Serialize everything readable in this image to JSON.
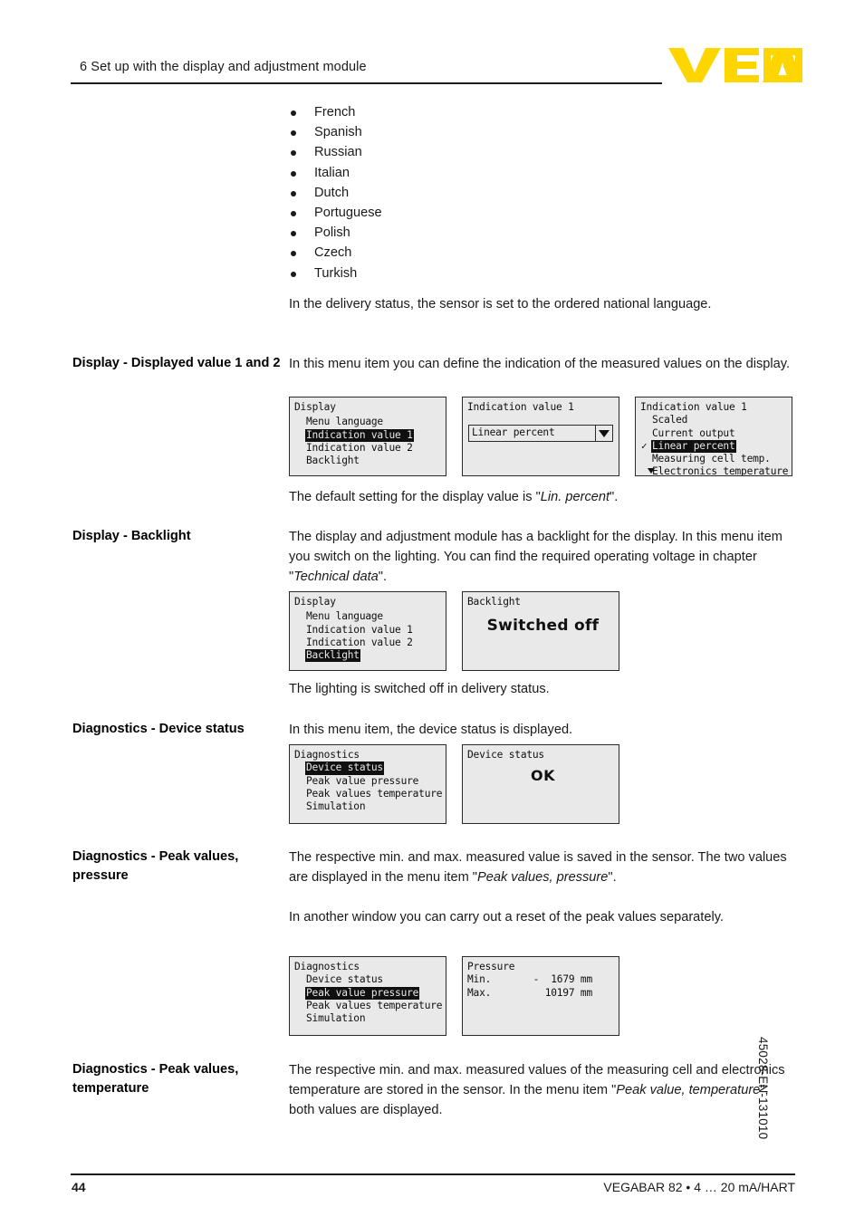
{
  "header": {
    "chapter_title": "6 Set up with the display and adjustment module",
    "logo_text": "VEGA",
    "logo_color": "#FFD500"
  },
  "language_list": [
    "French",
    "Spanish",
    "Russian",
    "Italian",
    "Dutch",
    "Portuguese",
    "Polish",
    "Czech",
    "Turkish"
  ],
  "intro_paragraph": "In the delivery status, the sensor is set to the ordered national language.",
  "sections": [
    {
      "heading": "Display - Displayed value 1 and 2",
      "body": "In this menu item you can define the indication of the measured values on the display.",
      "after_note_prefix": "The default setting for the display value is \"",
      "after_note_italic": "Lin. percent",
      "after_note_suffix": "\"."
    },
    {
      "heading": "Display - Backlight",
      "body_part1": "The display and adjustment module has a backlight for the display. In this menu item you switch on the lighting. You can find the required operating voltage in chapter  \"",
      "body_italic": "Technical data",
      "body_part2": "\".",
      "after_note": "The lighting is switched off in delivery status."
    },
    {
      "heading": "Diagnostics - Device status",
      "body": "In this menu item, the device status is displayed."
    },
    {
      "heading": "Diagnostics - Peak values, pressure",
      "body_part1": "The respective min. and max. measured value is saved in the sensor. The two values are displayed in the menu item \"",
      "body_italic": "Peak values, pressure",
      "body_part2": "\".",
      "body2": "In another window you can carry out a reset of the peak values separately."
    },
    {
      "heading": "Diagnostics - Peak values, temperature",
      "body_part1": "The respective min. and max. measured values of the measuring cell and electronics temperature are stored in the sensor. In the menu item \"",
      "body_italic": "Peak value, temperature",
      "body_part2": "\", both values are displayed."
    }
  ],
  "figures": {
    "display_value": {
      "panel1": {
        "title": "Display",
        "items": [
          {
            "label": "Menu language",
            "selected": false,
            "checked": false
          },
          {
            "label": "Indication value 1",
            "selected": true,
            "checked": false
          },
          {
            "label": "Indication value 2",
            "selected": false,
            "checked": false
          },
          {
            "label": "Backlight",
            "selected": false,
            "checked": false
          }
        ]
      },
      "panel2": {
        "title": "Indication value 1",
        "dropdown_value": "Linear percent"
      },
      "panel3": {
        "title": "Indication value 1",
        "items": [
          {
            "label": "Scaled",
            "selected": false,
            "checked": false
          },
          {
            "label": "Current output",
            "selected": false,
            "checked": false
          },
          {
            "label": "Linear percent",
            "selected": true,
            "checked": true
          },
          {
            "label": "Measuring cell temp.",
            "selected": false,
            "checked": false
          },
          {
            "label": "Electronics temperature",
            "selected": false,
            "checked": false
          }
        ],
        "more_indicator": true
      }
    },
    "backlight": {
      "panel1": {
        "title": "Display",
        "items": [
          {
            "label": "Menu language",
            "selected": false,
            "checked": false
          },
          {
            "label": "Indication value 1",
            "selected": false,
            "checked": false
          },
          {
            "label": "Indication value 2",
            "selected": false,
            "checked": false
          },
          {
            "label": "Backlight",
            "selected": true,
            "checked": false
          }
        ]
      },
      "panel2": {
        "title": "Backlight",
        "value": "Switched off"
      }
    },
    "device_status": {
      "panel1": {
        "title": "Diagnostics",
        "items": [
          {
            "label": "Device status",
            "selected": true,
            "checked": false
          },
          {
            "label": "Peak value pressure",
            "selected": false,
            "checked": false
          },
          {
            "label": "Peak values temperature",
            "selected": false,
            "checked": false
          },
          {
            "label": "Simulation",
            "selected": false,
            "checked": false
          }
        ]
      },
      "panel2": {
        "title": "Device status",
        "value": "OK"
      }
    },
    "peak_values": {
      "panel1": {
        "title": "Diagnostics",
        "items": [
          {
            "label": "Device status",
            "selected": false,
            "checked": false
          },
          {
            "label": "Peak value pressure",
            "selected": true,
            "checked": false
          },
          {
            "label": "Peak values temperature",
            "selected": false,
            "checked": false
          },
          {
            "label": "Simulation",
            "selected": false,
            "checked": false
          }
        ]
      },
      "panel2": {
        "title": "Pressure",
        "min_label": "Min.",
        "min_value": "-  1679 mm",
        "max_label": "Max.",
        "max_value": "10197 mm"
      }
    }
  },
  "footer": {
    "page_number": "44",
    "product": "VEGABAR 82 • 4 … 20 mA/HART",
    "doc_code": "45028-EN-131010"
  }
}
